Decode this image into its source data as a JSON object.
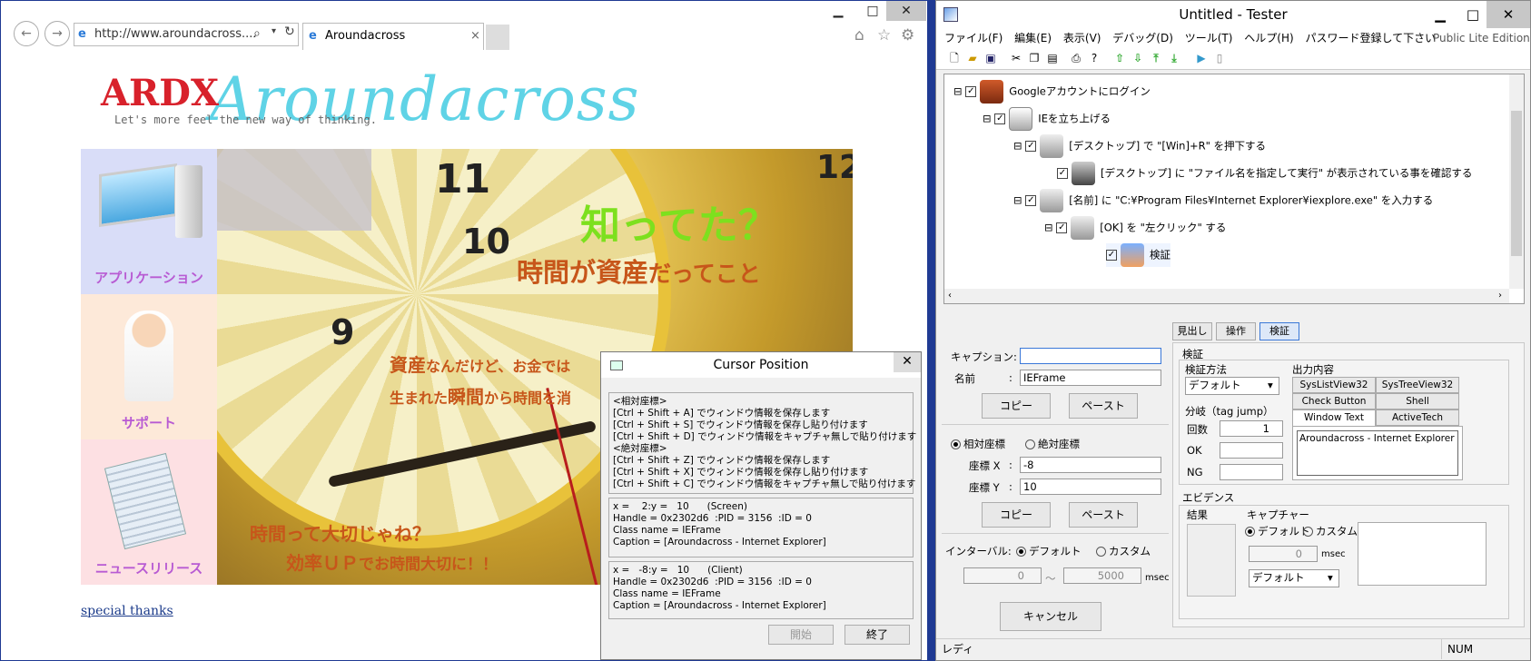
{
  "ie": {
    "address": "http://www.aroundacross....",
    "tab_title": "Aroundacross",
    "logo_text": "ARDX",
    "logo_script": "Aroundacross",
    "tagline": "Let's more feel the new way of thinking.",
    "side_items": [
      {
        "label": "アプリケーション",
        "icon": "computer-icon"
      },
      {
        "label": "サポート",
        "icon": "nurse-icon"
      },
      {
        "label": "ニュースリリース",
        "icon": "newspaper-icon"
      }
    ],
    "hero": {
      "headline": "知ってた？",
      "subhead_a": "時間が資産",
      "subhead_b": "だってこと",
      "line1_a": "資産",
      "line1_b": "なんだけど、お金では",
      "line2_a": "生まれた",
      "line2_b": "瞬間",
      "line2_c": "から時間を消",
      "footer1": "時間って大切じゃね？",
      "footer2_a": "効率ＵＰ",
      "footer2_b": "でお時間大切に！！",
      "clock_numbers": [
        "11",
        "10",
        "9",
        "12"
      ]
    },
    "special_thanks": "special thanks"
  },
  "cursor_dialog": {
    "title": "Cursor Position",
    "info_text": "<相対座標>\n[Ctrl + Shift + A] でウィンドウ情報を保存します\n[Ctrl + Shift + S] でウィンドウ情報を保存し貼り付けます\n[Ctrl + Shift + D] でウィンドウ情報をキャプチャ無しで貼り付けます\n<絶対座標>\n[Ctrl + Shift + Z] でウィンドウ情報を保存します\n[Ctrl + Shift + X] でウィンドウ情報を保存し貼り付けます\n[Ctrl + Shift + C] でウィンドウ情報をキャプチャ無しで貼り付けます",
    "screen_text": "x =    2:y =   10      (Screen)\nHandle = 0x2302d6  :PID = 3156  :ID = 0\nClass name = IEFrame\nCaption = [Aroundacross - Internet Explorer]",
    "client_text": "x =   -8:y =   10      (Client)\nHandle = 0x2302d6  :PID = 3156  :ID = 0\nClass name = IEFrame\nCaption = [Aroundacross - Internet Explorer]",
    "start_button": "開始",
    "end_button": "終了"
  },
  "tester": {
    "title": "Untitled - Tester",
    "menu": [
      "ファイル(F)",
      "編集(E)",
      "表示(V)",
      "デバッグ(D)",
      "ツール(T)",
      "ヘルプ(H)",
      "パスワード登録して下さい"
    ],
    "edition": "Public Lite Edition",
    "tree": [
      {
        "label": "Googleアカウントにログイン",
        "icon": "book-icon"
      },
      {
        "label": "IEを立ち上げる",
        "icon": "script-icon"
      },
      {
        "label": "[デスクトップ] で \"[Win]+R\" を押下する",
        "icon": "operation-icon"
      },
      {
        "label": "[デスクトップ] に \"ファイル名を指定して実行\" が表示されている事を確認する",
        "icon": "verify-icon"
      },
      {
        "label": "[名前] に \"C:¥Program Files¥Internet Explorer¥iexplore.exe\" を入力する",
        "icon": "operation-icon"
      },
      {
        "label": "[OK] を \"左クリック\" する",
        "icon": "operation-icon"
      },
      {
        "label": "検証",
        "icon": "verify-user-icon"
      }
    ],
    "tabs": [
      "見出し",
      "操作",
      "検証"
    ],
    "caption_label": "キャプション:",
    "caption_value": "",
    "name_label": "名前",
    "name_sep": ":",
    "name_value": "IEFrame",
    "copy_label": "コピー",
    "paste_label": "ペースト",
    "relative_label": "相対座標",
    "absolute_label": "絶対座標",
    "coord_x_label": "座標 X",
    "coord_x_value": "-8",
    "coord_y_label": "座標 Y",
    "coord_y_value": "10",
    "interval_label": "インターバル:",
    "default_label": "デフォルト",
    "custom_label": "カスタム",
    "interval_min": "0",
    "interval_max": "5000",
    "tilde": "～",
    "msec": "msec",
    "cancel_label": "キャンセル",
    "verify_group": "検証",
    "verify_method_label": "検証方法",
    "verify_method_value": "デフォルト",
    "branch_label": "分岐（tag jump）",
    "count_label": "回数",
    "count_value": "1",
    "ok_label": "OK",
    "ng_label": "NG",
    "output_label": "出力内容",
    "output_tabs": [
      "SysListView32",
      "SysTreeView32",
      "Check Button",
      "Shell",
      "Window Text",
      "ActiveTech"
    ],
    "output_value": "Aroundacross - Internet Explorer",
    "evidence_label": "エビデンス",
    "result_label": "結果",
    "capture_label": "キャプチャー",
    "capture_default": "デフォルト",
    "capture_custom": "カスタム",
    "capture_msec_value": "0",
    "capture_select": "デフォルト",
    "status_ready": "レディ",
    "status_num": "NUM"
  }
}
